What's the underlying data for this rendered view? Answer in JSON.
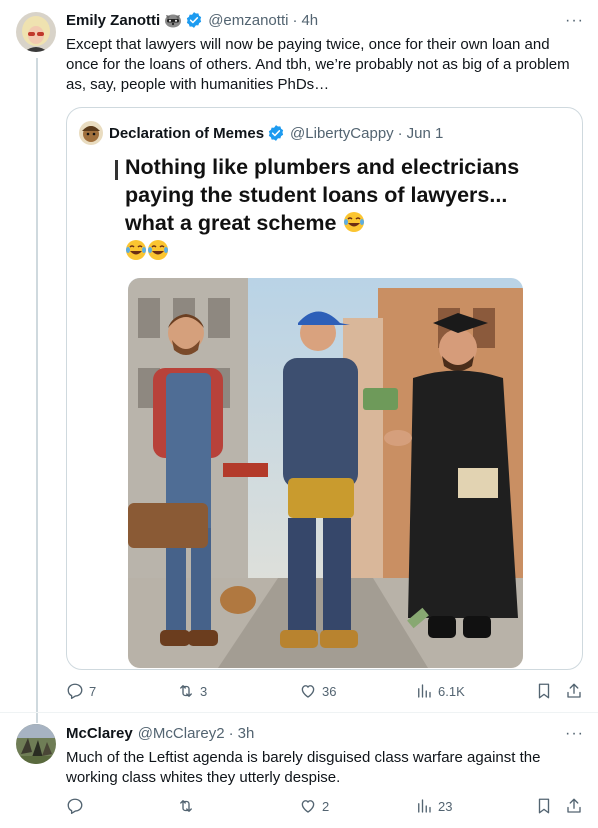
{
  "tweets": [
    {
      "name": "Emily Zanotti",
      "handle": "@emzanotti",
      "separator": "·",
      "time": "4h",
      "text": "Except that lawyers will now be paying twice, once for their own loan and once for the loans of others. And tbh, we’re probably not as big of a problem as, say, people with humanities PhDs…",
      "quote": {
        "name": "Declaration of Memes",
        "handle": "@LibertyCappy",
        "separator": "·",
        "time": "Jun 1",
        "meme_caption": "Nothing like plumbers and electricians paying the student loans of lawyers... what a great scheme"
      },
      "actions": {
        "replies": "7",
        "reposts": "3",
        "likes": "36",
        "views": "6.1K"
      }
    },
    {
      "name": "McClarey",
      "handle": "@McClarey2",
      "separator": "·",
      "time": "3h",
      "text": "Much of the Leftist agenda is barely disguised class warfare against the working class whites they utterly despise.",
      "actions": {
        "replies": "",
        "reposts": "",
        "likes": "2",
        "views": "23"
      }
    }
  ],
  "more_label": "···",
  "colors": {
    "verified": "#1d9bf0",
    "muted": "#536471",
    "border": "#cfd9de"
  },
  "icons": [
    "reply-icon",
    "repost-icon",
    "like-icon",
    "views-icon",
    "bookmark-icon",
    "share-icon",
    "verified-icon",
    "raccoon-icon",
    "laughing-emoji-icon"
  ]
}
